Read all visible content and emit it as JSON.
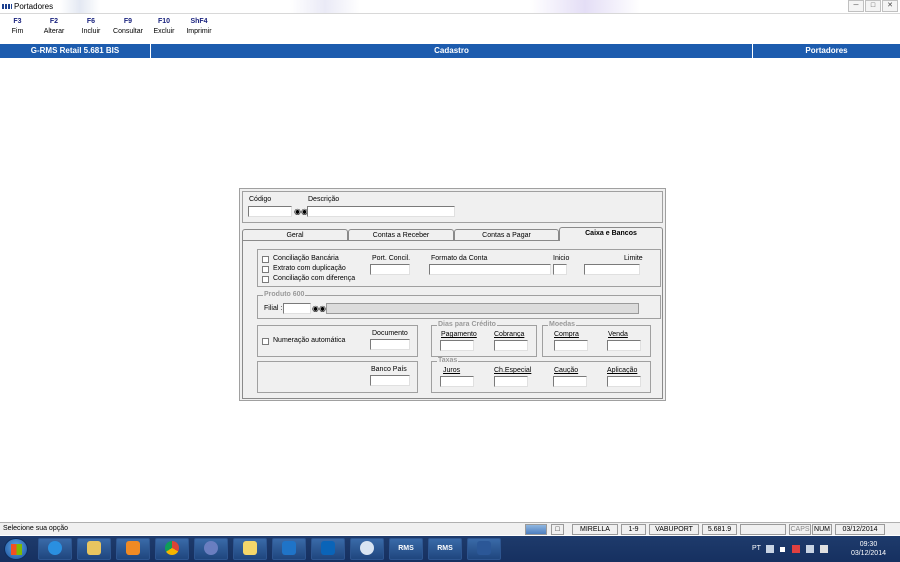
{
  "window": {
    "title": "Portadores",
    "controls": [
      "minimize",
      "maximize",
      "close"
    ]
  },
  "toolbar": {
    "keys": [
      {
        "key": "F3",
        "label": "Fim"
      },
      {
        "key": "F2",
        "label": "Alterar"
      },
      {
        "key": "F6",
        "label": "Incluir"
      },
      {
        "key": "F9",
        "label": "Consultar"
      },
      {
        "key": "F10",
        "label": "Excluir"
      },
      {
        "key": "ShF4",
        "label": "Imprimir"
      }
    ]
  },
  "header": {
    "app_version": "G-RMS Retail 5.681 BIS",
    "section": "Cadastro",
    "screen": "Portadores"
  },
  "form": {
    "codigo_label": "Código",
    "codigo_value": "",
    "descricao_label": "Descrição",
    "descricao_value": "",
    "tabs": [
      {
        "label": "Geral",
        "active": false
      },
      {
        "label": "Contas a Receber",
        "active": false
      },
      {
        "label": "Contas a Pagar",
        "active": false
      },
      {
        "label": "Caixa e Bancos",
        "active": true
      }
    ],
    "caixa_bancos": {
      "conciliacao_bancaria": "Conciliação Bancária",
      "extrato_duplicacao": "Extrato com duplicação",
      "conciliacao_diferenca": "Conciliação com diferença",
      "port_concil": "Port. Concil.",
      "formato_conta": "Formato da Conta",
      "inicio": "Inicio",
      "limite": "Limite",
      "produto_legend": "Produto 600",
      "filial_label": "Filial :",
      "numeracao_automatica": "Numeração automática",
      "documento": "Documento",
      "dias_credito_legend": "Dias para Crédito",
      "pagamento": "Pagamento",
      "cobranca": "Cobrança",
      "moedas_legend": "Moedas",
      "compra": "Compra",
      "venda": "Venda",
      "banco_pais": "Banco País",
      "taxas_legend": "Taxas",
      "juros": "Juros",
      "ch_especial": "Ch.Especial",
      "caucao": "Caução",
      "aplicacao": "Aplicação"
    }
  },
  "statusbar": {
    "message": "Selecione sua opção",
    "user": "MIRELLA",
    "range": "1-9",
    "program": "VABUPORT",
    "version": "5.681.9",
    "caps": "CAPS",
    "num": "NUM",
    "date": "03/12/2014"
  },
  "taskbar": {
    "apps": [
      "internet-explorer",
      "file-explorer",
      "media-player",
      "chrome",
      "app-cd",
      "folder-yellow",
      "lync",
      "outlook",
      "app-circle",
      "rms-1",
      "rms-2",
      "word"
    ],
    "rms_label": "RMS",
    "language": "PT",
    "time": "09:30",
    "date": "03/12/2014"
  },
  "colors": {
    "header_blue": "#1d5cae",
    "taskbar": "#1e3b6c",
    "form_bg": "#f0f0f0"
  }
}
